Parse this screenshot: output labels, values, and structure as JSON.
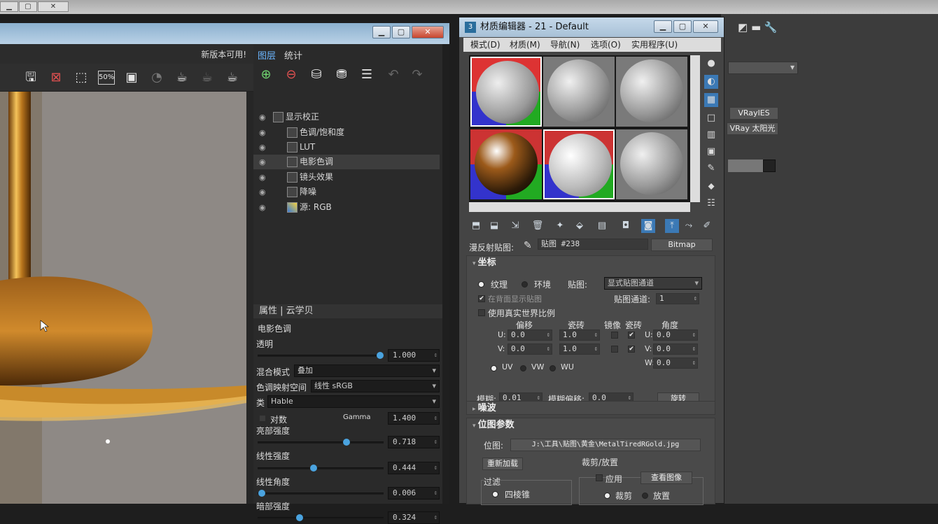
{
  "colors": {
    "accent": "#4aa3df",
    "panel": "#2a2a2a",
    "title_blue": "#b9d1e6"
  },
  "vfb": {
    "update_notice": "新版本可用!",
    "toolbar_icons": [
      "save-icon",
      "clear-icon",
      "region-select-icon",
      "zoom-50-icon",
      "frame-icon",
      "teapot-render-icon",
      "teapot-stop-icon",
      "teapot-icon"
    ],
    "zoom_label": "50%",
    "tabs": {
      "layers": "图层",
      "stats": "统计"
    },
    "layers": [
      {
        "label": "显示校正",
        "indent": 0
      },
      {
        "label": "色调/饱和度",
        "indent": 1
      },
      {
        "label": "LUT",
        "indent": 1
      },
      {
        "label": "电影色调",
        "indent": 1,
        "selected": true
      },
      {
        "label": "镜头效果",
        "indent": 1
      },
      {
        "label": "降噪",
        "indent": 1
      },
      {
        "label": "源: RGB",
        "indent": 1
      }
    ],
    "props_header": "属性 | 云学贝",
    "props_title": "电影色调",
    "opacity": {
      "label": "透明",
      "value": "1.000",
      "level": 1.0
    },
    "blend": {
      "label": "混合模式",
      "value": "叠加"
    },
    "tonemap": {
      "label": "色调映射空间",
      "value": "线性 sRGB"
    },
    "type": {
      "label": "类",
      "value": "Hable"
    },
    "log": {
      "label": "对数",
      "gamma_label": "Gamma",
      "gamma": "1.400"
    },
    "highlight": {
      "label": "亮部强度",
      "value": "0.718",
      "level": 0.718
    },
    "linear": {
      "label": "线性强度",
      "value": "0.444",
      "level": 0.444
    },
    "linear_angle": {
      "label": "线性角度",
      "value": "0.006",
      "level": 0.006
    },
    "shadow": {
      "label": "暗部强度",
      "value": "0.324",
      "level": 0.324
    }
  },
  "me": {
    "title": "材质编辑器 - 21 - Default",
    "menu": [
      "模式(D)",
      "材质(M)",
      "导航(N)",
      "选项(O)",
      "实用程序(U)"
    ],
    "diffuse_label": "漫反射贴图:",
    "map_name": "贴图 #238",
    "map_type": "Bitmap",
    "coords": {
      "header": "坐标",
      "texture": "纹理",
      "environ": "环境",
      "mapping_label": "贴图:",
      "mapping": "显式贴图通道",
      "show_back": "在背面显示贴图",
      "channel_label": "贴图通道:",
      "channel": "1",
      "real_world": "使用真实世界比例",
      "offset": "偏移",
      "tiling": "瓷砖",
      "mirror": "镜像",
      "tile": "瓷砖",
      "angle": "角度",
      "u": "U:",
      "v": "V:",
      "w": "W:",
      "u_offset": "0.0",
      "v_offset": "0.0",
      "u_tiling": "1.0",
      "v_tiling": "1.0",
      "u_angle": "0.0",
      "v_angle": "0.0",
      "w_angle": "0.0",
      "uv": "UV",
      "vw": "VW",
      "wu": "WU",
      "blur_label": "模糊:",
      "blur": "0.01",
      "blur_offset_label": "模糊偏移:",
      "blur_offset": "0.0",
      "rotate": "旋转"
    },
    "noise": {
      "header": "噪波"
    },
    "bitmap": {
      "header": "位图参数",
      "path_label": "位图:",
      "path": "J:\\工具\\贴图\\黄金\\MetalTiredRGold.jpg",
      "reload": "重新加载",
      "crop_label": "裁剪/放置",
      "filter_label": "过滤",
      "four_corner": "四棱锥",
      "apply": "应用",
      "view_image": "查看图像",
      "crop": "裁剪",
      "place": "放置"
    }
  },
  "host": {
    "vray_ies": "VRayIES",
    "vray_sun": "VRay 太阳光"
  }
}
